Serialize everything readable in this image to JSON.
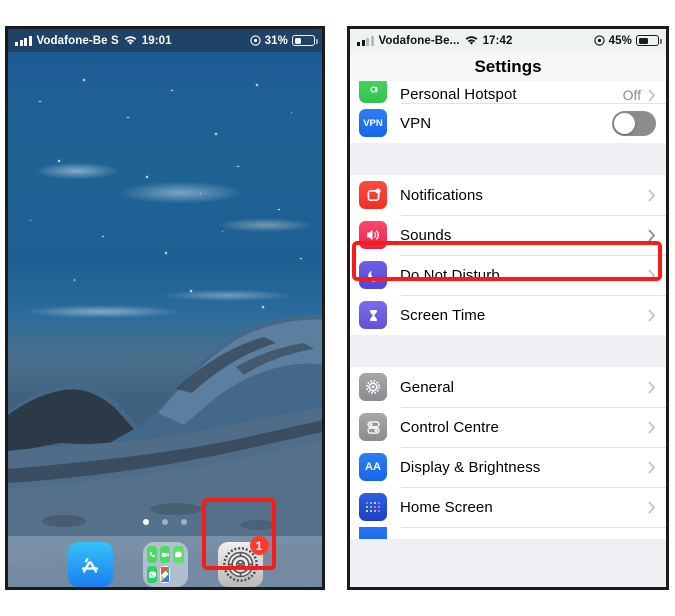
{
  "left_phone": {
    "status_bar": {
      "carrier": "Vodafone-Be S",
      "time": "19:01",
      "battery_percent": "31%",
      "signal_icon": "signal-bars-icon",
      "wifi_icon": "wifi-icon",
      "location_icon": "location-services-icon",
      "battery_icon": "battery-icon"
    },
    "wallpaper": {
      "description": "snowy mountain at night",
      "sky_color": "#1d5c93",
      "snow_color": "#4a6f8c"
    },
    "page_dots": {
      "count": 3,
      "active_index": 0
    },
    "dock": {
      "apps": [
        {
          "name": "App Store",
          "icon": "app-store-icon",
          "badge": ""
        },
        {
          "name": "Communication Folder",
          "icon": "folder-icon",
          "badge": ""
        },
        {
          "name": "Settings",
          "icon": "settings-gear-icon",
          "badge": "1"
        }
      ],
      "folder_apps": [
        "Phone",
        "FaceTime",
        "Messages",
        "WhatsApp",
        "Shortcuts"
      ]
    },
    "highlight": {
      "target": "Settings",
      "color": "#f91b18"
    }
  },
  "right_phone": {
    "status_bar": {
      "carrier": "Vodafone-Be...",
      "time": "17:42",
      "battery_percent": "45%",
      "signal_icon": "signal-bars-icon",
      "wifi_icon": "wifi-icon",
      "location_icon": "location-services-icon",
      "battery_icon": "battery-icon"
    },
    "nav": {
      "title": "Settings"
    },
    "highlight": {
      "target": "Sounds",
      "color": "#f91b18"
    },
    "groups": [
      {
        "rows": [
          {
            "label": "Personal Hotspot",
            "value": "Off",
            "icon": "personal-hotspot-icon",
            "icon_color": "#30c24c",
            "control": "chevron",
            "clipped": true
          },
          {
            "label": "VPN",
            "value": "",
            "icon": "vpn-icon",
            "icon_color": "#1565e8",
            "control": "toggle",
            "toggle_on": false,
            "clipped": false
          }
        ]
      },
      {
        "rows": [
          {
            "label": "Notifications",
            "value": "",
            "icon": "notifications-icon",
            "icon_color": "#ef2f26",
            "control": "chevron",
            "clipped": false
          },
          {
            "label": "Sounds",
            "value": "",
            "icon": "sounds-speaker-icon",
            "icon_color": "#e8214d",
            "control": "chevron",
            "clipped": false,
            "highlighted": true
          },
          {
            "label": "Do Not Disturb",
            "value": "",
            "icon": "do-not-disturb-moon-icon",
            "icon_color": "#5247d6",
            "control": "chevron",
            "clipped": false
          },
          {
            "label": "Screen Time",
            "value": "",
            "icon": "screen-time-hourglass-icon",
            "icon_color": "#6151d8",
            "control": "chevron",
            "clipped": false
          }
        ]
      },
      {
        "rows": [
          {
            "label": "General",
            "value": "",
            "icon": "general-gear-icon",
            "icon_color": "#8b8b90",
            "control": "chevron",
            "clipped": false
          },
          {
            "label": "Control Centre",
            "value": "",
            "icon": "control-centre-icon",
            "icon_color": "#8b8b90",
            "control": "chevron",
            "clipped": false
          },
          {
            "label": "Display & Brightness",
            "value": "",
            "icon": "display-brightness-icon",
            "icon_color": "#1565e8",
            "control": "chevron",
            "clipped": false
          },
          {
            "label": "Home Screen",
            "value": "",
            "icon": "home-screen-icon",
            "icon_color": "#1d3fc6",
            "control": "chevron",
            "clipped": false
          }
        ]
      }
    ]
  }
}
